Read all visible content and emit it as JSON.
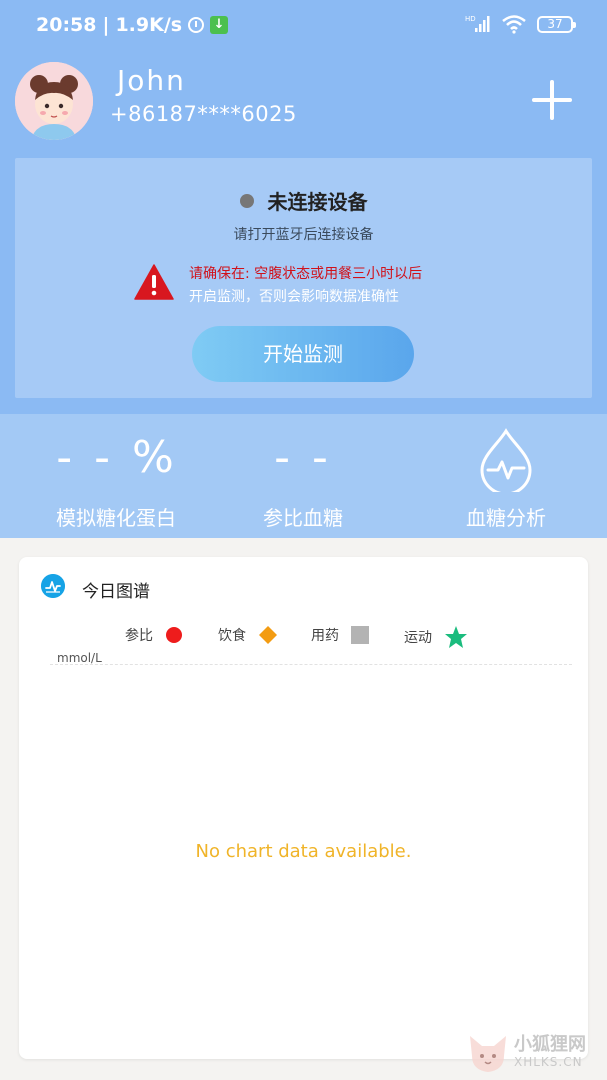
{
  "status_bar": {
    "time": "20:58",
    "network_speed": "1.9K/s",
    "alarm_icon": "alarm-clock-icon",
    "download_icon": "download-icon",
    "signal_label": "HD",
    "wifi_icon": "wifi-icon",
    "battery_level": "37"
  },
  "profile": {
    "name": "John",
    "phone": "+86187****6025",
    "add_icon": "plus-icon"
  },
  "device": {
    "status_text": "未连接设备",
    "hint": "请打开蓝牙后连接设备",
    "warning_line1": "请确保在: 空腹状态或用餐三小时以后",
    "warning_line2": "开启监测，否则会影响数据准确性",
    "start_button": "开始监测",
    "status_dot_color": "#777777",
    "warning_color": "#d0121b"
  },
  "stats": {
    "hba1c_value": "- - %",
    "hba1c_label": "模拟糖化蛋白",
    "ref_glucose_value": "- -",
    "ref_glucose_label": "参比血糖",
    "analysis_label": "血糖分析",
    "analysis_icon": "blood-drop-pulse-icon"
  },
  "chart_card": {
    "title": "今日图谱",
    "legend": [
      {
        "label": "参比",
        "marker": "circle",
        "color": "#ee1c1c"
      },
      {
        "label": "饮食",
        "marker": "diamond",
        "color": "#f39c12"
      },
      {
        "label": "用药",
        "marker": "square",
        "color": "#b3b3b3"
      },
      {
        "label": "运动",
        "marker": "star",
        "color": "#1bbc7e"
      }
    ],
    "unit": "mmol/L",
    "empty_message": "No chart data available."
  },
  "watermark": {
    "line1": "小狐狸网",
    "line2": "XHLKS.CN"
  }
}
